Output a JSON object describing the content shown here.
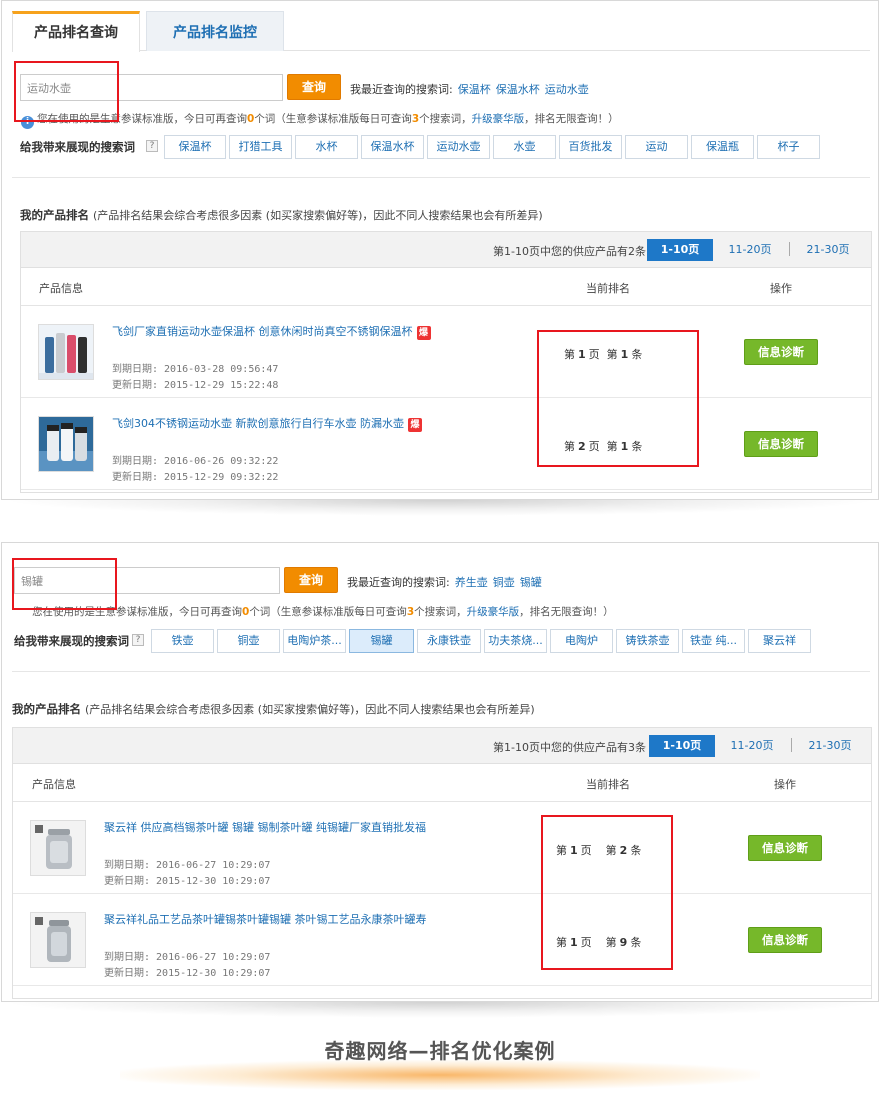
{
  "panel1": {
    "tabs": {
      "active": "产品排名查询",
      "inactive": "产品排名监控"
    },
    "search": {
      "value": "运动水壶",
      "button": "查询"
    },
    "recent": {
      "label": "我最近查询的搜索词:",
      "terms": [
        "保温杯",
        "保温水杯",
        "运动水壶"
      ]
    },
    "notice": {
      "icon": "info-icon",
      "before": "您在使用的是生意参谋标准版，今日可再查询",
      "count1": "0",
      "middle": "个词（生意参谋标准版每日可查询",
      "count2": "3",
      "after": "个搜索词，",
      "link": "升级豪华版",
      "end": "，排名无限查询！）"
    },
    "keywords": {
      "label": "给我带来展现的搜索词",
      "items": [
        "保温杯",
        "打猎工具",
        "水杯",
        "保温水杯",
        "运动水壶",
        "水壶",
        "百货批发",
        "运动",
        "保温瓶",
        "杯子"
      ]
    },
    "rank_title": {
      "bold": "我的产品排名",
      "note": "(产品排名结果会综合考虑很多因素 (如买家搜索偏好等)，因此不同人搜索结果也会有所差异)"
    },
    "pager": {
      "summary": "第1-10页中您的供应产品有2条",
      "pages": [
        "1-10页",
        "11-20页",
        "21-30页"
      ]
    },
    "headers": {
      "info": "产品信息",
      "rank": "当前排名",
      "action": "操作"
    },
    "rows": [
      {
        "title": "飞剑厂家直销运动水壶保温杯 创意休闲时尚真空不锈钢保温杯",
        "hot": "爆",
        "expire": "到期日期: 2016-03-28 09:56:47",
        "update": "更新日期: 2015-12-29 15:22:48",
        "page_pre": "第",
        "page": "1",
        "page_post": "页",
        "item_pre": "第",
        "item": "1",
        "item_post": "条",
        "button": "信息诊断"
      },
      {
        "title": "飞剑304不锈钢运动水壶 新款创意旅行自行车水壶 防漏水壶",
        "hot": "爆",
        "expire": "到期日期: 2016-06-26 09:32:22",
        "update": "更新日期: 2015-12-29 09:32:22",
        "page_pre": "第",
        "page": "2",
        "page_post": "页",
        "item_pre": "第",
        "item": "1",
        "item_post": "条",
        "button": "信息诊断"
      }
    ]
  },
  "panel2": {
    "search": {
      "value": "锡罐",
      "button": "查询"
    },
    "recent": {
      "label": "我最近查询的搜索词:",
      "terms": [
        "养生壶",
        "铜壶",
        "锡罐"
      ]
    },
    "notice": {
      "before": "您在使用的是生意参谋标准版，今日可再查询",
      "count1": "0",
      "middle": "个词（生意参谋标准版每日可查询",
      "count2": "3",
      "after": "个搜索词，",
      "link": "升级豪华版",
      "end": "，排名无限查询！）"
    },
    "keywords": {
      "label": "给我带来展现的搜索词",
      "items": [
        "铁壶",
        "铜壶",
        "电陶炉茶...",
        "锡罐",
        "永康铁壶",
        "功夫茶烧...",
        "电陶炉",
        "铸铁茶壶",
        "铁壶 纯...",
        "聚云祥"
      ]
    },
    "rank_title": {
      "bold": "我的产品排名",
      "note": "(产品排名结果会综合考虑很多因素 (如买家搜索偏好等)，因此不同人搜索结果也会有所差异)"
    },
    "pager": {
      "summary": "第1-10页中您的供应产品有3条",
      "pages": [
        "1-10页",
        "11-20页",
        "21-30页"
      ]
    },
    "headers": {
      "info": "产品信息",
      "rank": "当前排名",
      "action": "操作"
    },
    "rows": [
      {
        "title": "聚云祥 供应高档锡茶叶罐 锡罐 锡制茶叶罐 纯锡罐厂家直销批发福",
        "expire": "到期日期: 2016-06-27 10:29:07",
        "update": "更新日期: 2015-12-30 10:29:07",
        "page_pre": "第",
        "page": "1",
        "page_post": "页",
        "item_pre": "第",
        "item": "2",
        "item_post": "条",
        "button": "信息诊断"
      },
      {
        "title": "聚云祥礼品工艺品茶叶罐锡茶叶罐锡罐 茶叶锡工艺品永康茶叶罐寿",
        "expire": "到期日期: 2016-06-27 10:29:07",
        "update": "更新日期: 2015-12-30 10:29:07",
        "page_pre": "第",
        "page": "1",
        "page_post": "页",
        "item_pre": "第",
        "item": "9",
        "item_post": "条",
        "button": "信息诊断"
      }
    ]
  },
  "footer": {
    "title": "奇趣网络—排名优化案例"
  },
  "colors": {
    "accent_orange": "#f28c00",
    "link_blue": "#1e6fb3",
    "diag_green": "#76b82a",
    "highlight_red": "#e8171e"
  }
}
